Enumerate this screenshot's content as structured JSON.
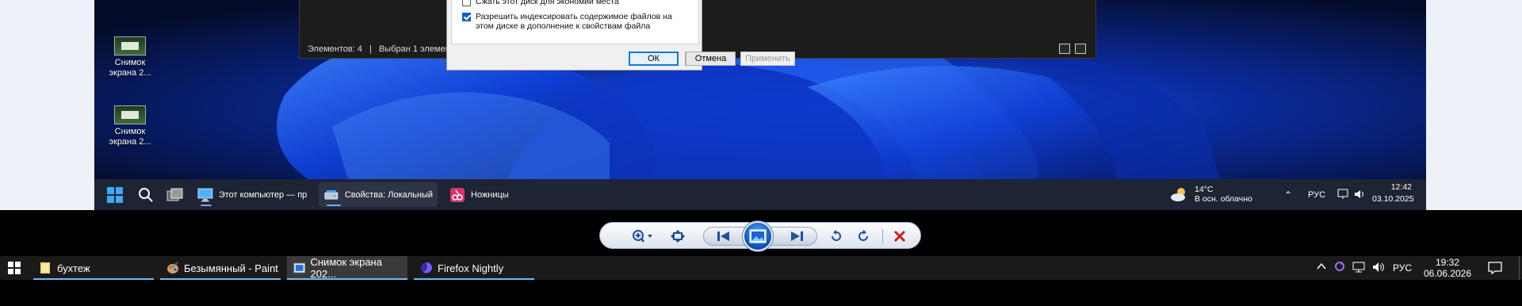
{
  "desktop": {
    "icons": [
      {
        "label": "Снимок\nэкрана 2..."
      },
      {
        "label": "Снимок\nэкрана 2..."
      }
    ]
  },
  "explorer": {
    "status_items": "Элементов: 4",
    "status_separator": "|",
    "status_selected": "Выбран 1 элемент"
  },
  "properties_dialog": {
    "compress_label": "Сжать этот диск для экономии места",
    "compress_checked": false,
    "index_label": "Разрешить индексировать содержимое файлов на этом диске в дополнение к свойствам файла",
    "index_checked": true,
    "ok_label": "ОК",
    "cancel_label": "Отмена",
    "apply_label": "Применить"
  },
  "inner_taskbar": {
    "items": [
      {
        "label": "Этот компьютер — про",
        "icon": "monitor-icon"
      },
      {
        "label": "Свойства: Локальный д",
        "icon": "drive-icon"
      },
      {
        "label": "Ножницы",
        "icon": "snipping-tool-icon"
      }
    ],
    "weather_temp": "14°C",
    "weather_desc": "В осн. облачно",
    "language": "РУС",
    "time": "12:42",
    "date": "03.10.2025"
  },
  "viewer_toolbar": {
    "buttons": [
      "zoom-icon",
      "fit-icon",
      "previous-icon",
      "slideshow-icon",
      "next-icon",
      "rotate-left-icon",
      "rotate-right-icon",
      "delete-icon"
    ]
  },
  "outer_taskbar": {
    "items": [
      {
        "label": "бухтеж",
        "icon": "folder-icon"
      },
      {
        "label": "Безымянный - Paint",
        "icon": "paint-icon"
      },
      {
        "label": "Снимок экрана 202...",
        "icon": "photo-viewer-icon"
      },
      {
        "label": "Firefox Nightly",
        "icon": "firefox-icon"
      }
    ],
    "language": "РУС",
    "time": "19:32",
    "date": "06.06.2026"
  },
  "colors": {
    "accent": "#76b9ed",
    "dialog_primary": "#1976d2",
    "delete": "#d11a1a"
  }
}
